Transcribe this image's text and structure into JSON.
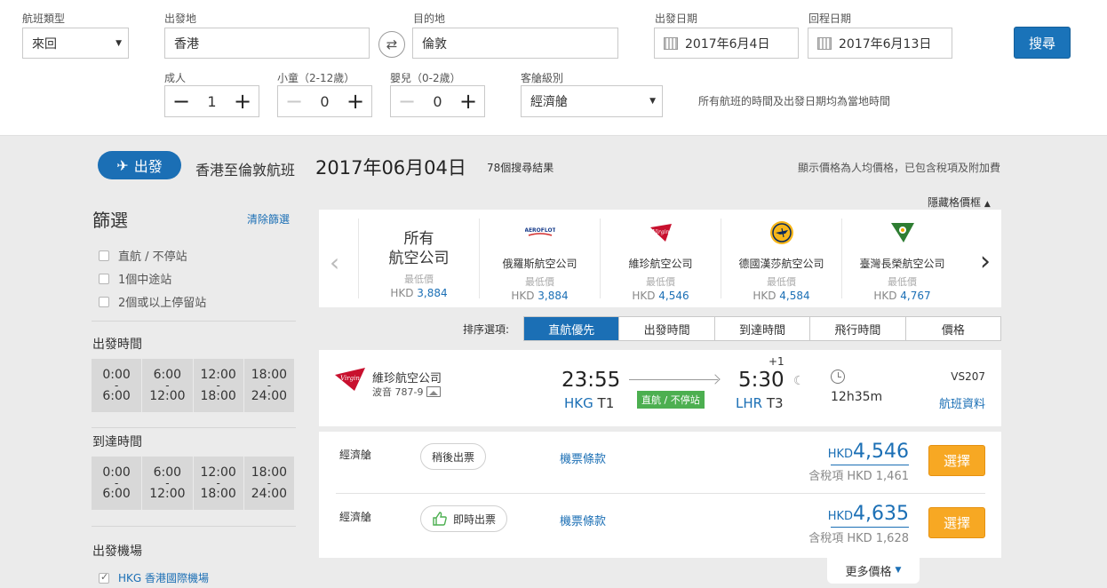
{
  "search": {
    "trip_type_label": "航班類型",
    "trip_type_value": "來回",
    "origin_label": "出發地",
    "origin_value": "香港",
    "destination_label": "目的地",
    "destination_value": "倫敦",
    "depart_date_label": "出發日期",
    "depart_date_value": "2017年6月4日",
    "return_date_label": "回程日期",
    "return_date_value": "2017年6月13日",
    "search_button": "搜尋",
    "adults_label": "成人",
    "adults_value": "1",
    "children_label": "小童（2-12歲）",
    "children_value": "0",
    "infants_label": "嬰兒（0-2歲）",
    "infants_value": "0",
    "cabin_label": "客艙級別",
    "cabin_value": "經濟艙",
    "local_time_note": "所有航班的時間及出發日期均為當地時間"
  },
  "header": {
    "badge": "出發",
    "route": "香港至倫敦航班",
    "date": "2017年06月04日",
    "results": "78個搜尋結果",
    "price_note": "顯示價格為人均價格，已包含稅項及附加費",
    "hide_grid": "隱藏格價框"
  },
  "sidebar": {
    "title": "篩選",
    "clear": "清除篩選",
    "stops": [
      "直航 / 不停站",
      "1個中途站",
      "2個或以上停留站"
    ],
    "departure_time_title": "出發時間",
    "arrival_time_title": "到達時間",
    "time_slots": [
      {
        "from": "0:00",
        "to": "6:00"
      },
      {
        "from": "6:00",
        "to": "12:00"
      },
      {
        "from": "12:00",
        "to": "18:00"
      },
      {
        "from": "18:00",
        "to": "24:00"
      }
    ],
    "departure_airport_title": "出發機場",
    "airport_option": "HKG 香港國際機場"
  },
  "airlines": {
    "all": {
      "line1": "所有",
      "line2": "航空公司",
      "lowest": "最低價",
      "currency": "HKD",
      "price": "3,884"
    },
    "items": [
      {
        "name": "俄羅斯航空公司",
        "lowest": "最低價",
        "currency": "HKD",
        "price": "3,884",
        "logo_text": "AEROFLOT"
      },
      {
        "name": "維珍航空公司",
        "lowest": "最低價",
        "currency": "HKD",
        "price": "4,546",
        "logo_text": "Virgin"
      },
      {
        "name": "德國漢莎航空公司",
        "lowest": "最低價",
        "currency": "HKD",
        "price": "4,584",
        "logo_text": ""
      },
      {
        "name": "臺灣長榮航空公司",
        "lowest": "最低價",
        "currency": "HKD",
        "price": "4,767",
        "logo_text": ""
      }
    ]
  },
  "sort": {
    "label": "排序選項:",
    "tabs": [
      "直航優先",
      "出發時間",
      "到達時間",
      "飛行時間",
      "價格"
    ]
  },
  "flight": {
    "airline": "維珍航空公司",
    "logo_text": "Virgin",
    "aircraft": "波音 787-9",
    "dep_time": "23:55",
    "dep_code": "HKG",
    "dep_terminal": "T1",
    "direct_tag": "直航 / 不停站",
    "day_offset": "+1",
    "arr_time": "5:30",
    "arr_code": "LHR",
    "arr_terminal": "T3",
    "duration": "12h35m",
    "flight_no": "VS207",
    "info_link": "航班資料"
  },
  "fares": [
    {
      "class": "經濟艙",
      "ticketing": "稍後出票",
      "terms": "機票條款",
      "currency": "HKD",
      "price": "4,546",
      "tax": "含稅項 HKD 1,461",
      "button": "選擇"
    },
    {
      "class": "經濟艙",
      "ticketing": "即時出票",
      "terms": "機票條款",
      "currency": "HKD",
      "price": "4,635",
      "tax": "含稅項 HKD 1,628",
      "button": "選擇"
    }
  ],
  "more_prices": "更多價格",
  "colors": {
    "primary": "#1b6fb5",
    "accent": "#f7a823",
    "direct": "#4caf50",
    "virgin": "#c8102e",
    "lufthansa": "#f7b618",
    "eva": "#2e7d32"
  },
  "icons": {
    "plane": "plane-icon",
    "swap": "swap-icon",
    "calendar": "calendar-icon",
    "clock": "clock-icon",
    "moon": "moon-icon",
    "camera": "photo-icon",
    "thumb": "thumbs-up-icon"
  }
}
